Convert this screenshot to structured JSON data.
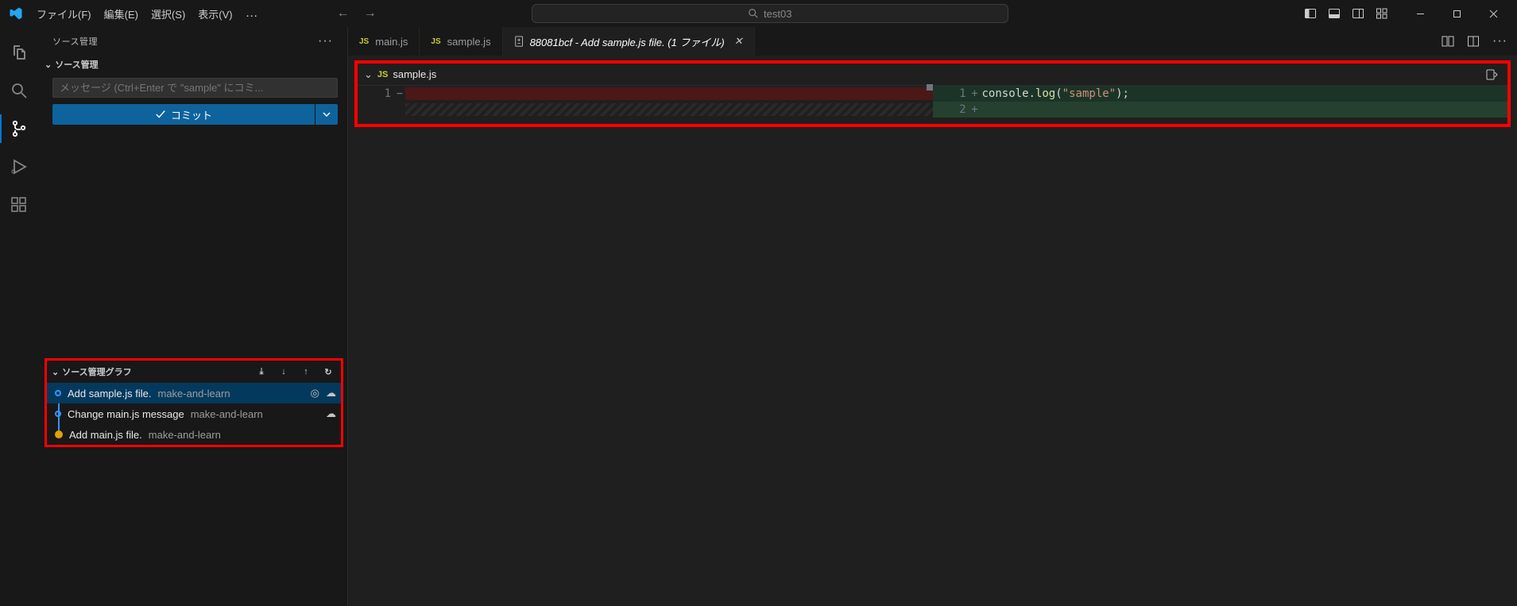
{
  "menu": {
    "file": "ファイル(F)",
    "edit": "編集(E)",
    "select": "選択(S)",
    "view": "表示(V)",
    "overflow": "…"
  },
  "nav": {
    "back": "←",
    "fwd": "→"
  },
  "command_center": {
    "text": "test03"
  },
  "sidebar": {
    "title": "ソース管理",
    "section": "ソース管理",
    "commit_placeholder": "メッセージ (Ctrl+Enter で \"sample\" にコミ...",
    "commit_button": "コミット"
  },
  "graph": {
    "title": "ソース管理グラフ",
    "rows": [
      {
        "msg": "Add sample.js file.",
        "author": "make-and-learn"
      },
      {
        "msg": "Change main.js message",
        "author": "make-and-learn"
      },
      {
        "msg": "Add main.js file.",
        "author": "make-and-learn"
      }
    ]
  },
  "tabs": {
    "items": [
      {
        "label": "main.js"
      },
      {
        "label": "sample.js"
      },
      {
        "label": "88081bcf - Add sample.js file. (1 ファイル)"
      }
    ]
  },
  "diff": {
    "filename": "sample.js",
    "left": {
      "ln1": "1"
    },
    "right": {
      "ln1": "1",
      "ln2": "2",
      "code1_a": "console.",
      "code1_b": "log",
      "code1_c": "(",
      "code1_d": "\"sample\"",
      "code1_e": ");"
    }
  }
}
